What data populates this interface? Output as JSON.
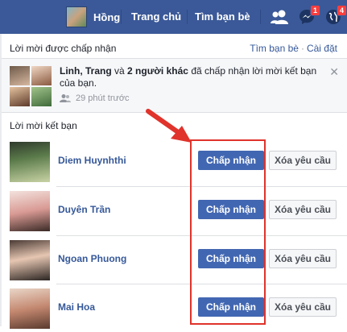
{
  "header": {
    "profile_name": "Hồng",
    "home_label": "Trang chủ",
    "find_friends_label": "Tìm bạn bè",
    "messages_badge": "1",
    "notifications_badge": "4",
    "bar_color": "#3b5998"
  },
  "accepted": {
    "title": "Lời mời được chấp nhận",
    "find_friends_link": "Tìm bạn bè",
    "settings_link": "Cài đặt",
    "separator": "·",
    "notification": {
      "names": "Linh, Trang",
      "and": "và",
      "others": "2 người khác",
      "rest": "đã chấp nhận lời mời kết bạn của bạn.",
      "time": "29 phút trước"
    }
  },
  "requests": {
    "title": "Lời mời kết bạn",
    "accept_label": "Chấp nhận",
    "delete_label": "Xóa yêu cầu",
    "items": [
      {
        "name": "Diem Huynhthi"
      },
      {
        "name": "Duyên Trần"
      },
      {
        "name": "Ngoan Phuong"
      },
      {
        "name": "Mai Hoa"
      }
    ]
  },
  "colors": {
    "accept_button": "#4267b2",
    "link": "#365899",
    "annotation": "#e0332b"
  }
}
